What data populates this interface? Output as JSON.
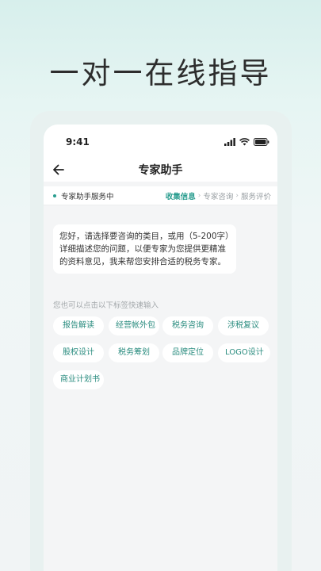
{
  "hero_title": "一对一在线指导",
  "status_bar": {
    "time": "9:41"
  },
  "navbar": {
    "title": "专家助手"
  },
  "service": {
    "label": "专家助手服务中",
    "steps": [
      "收集信息",
      "专家咨询",
      "服务评价"
    ],
    "active_step": 0
  },
  "chat": {
    "message": "您好，请选择要咨询的类目，或用（5-200字）详细描述您的问题，以便专家为您提供更精准的资料意见，我来帮您安排合适的税务专家。"
  },
  "quick_tags": {
    "hint": "您也可以点击以下标签快速输入",
    "tags": [
      "报告解读",
      "经营帐外包",
      "税务咨询",
      "涉税复议",
      "股权设计",
      "税务筹划",
      "品牌定位",
      "LOGO设计",
      "商业计划书"
    ]
  },
  "colors": {
    "accent": "#2a9d8f",
    "tag_text": "#2a8c7f"
  }
}
